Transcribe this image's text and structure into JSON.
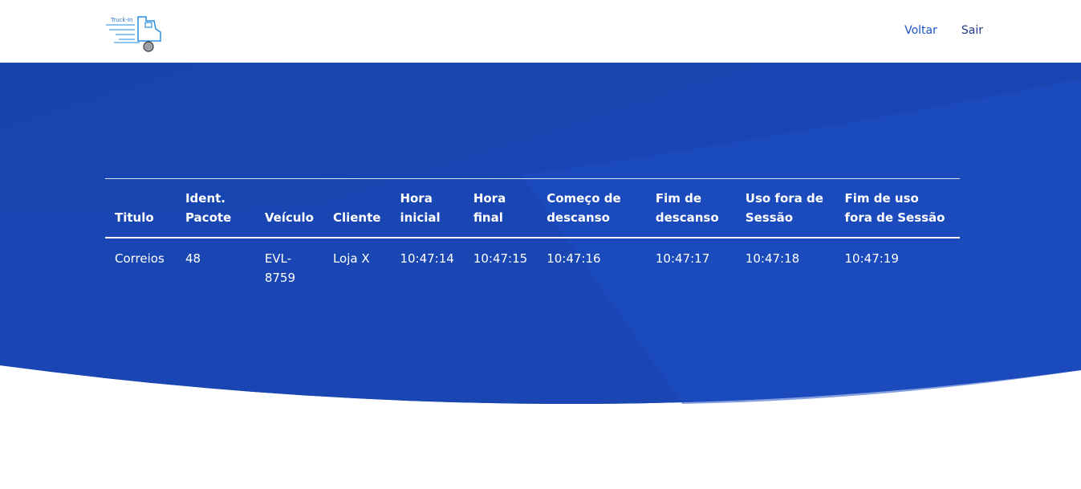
{
  "brand": {
    "logo_text": "Truck-In"
  },
  "nav": {
    "voltar": "Voltar",
    "sair": "Sair"
  },
  "table": {
    "headers": {
      "titulo": "Titulo",
      "ident": "Ident. Pacote",
      "veiculo": "Veículo",
      "cliente": "Cliente",
      "hora_inicial": "Hora inicial",
      "hora_final": "Hora final",
      "comeco_descanso": "Começo de descanso",
      "fim_descanso": "Fim de descanso",
      "uso_fora": "Uso fora de Sessão",
      "fim_uso_fora": "Fim de uso fora de Sessão"
    },
    "rows": [
      {
        "titulo": "Correios",
        "ident": "48",
        "veiculo": "EVL-8759",
        "cliente": "Loja X",
        "hora_inicial": "10:47:14",
        "hora_final": "10:47:15",
        "comeco_descanso": "10:47:16",
        "fim_descanso": "10:47:17",
        "uso_fora": "10:47:18",
        "fim_uso_fora": "10:47:19"
      }
    ]
  },
  "colors": {
    "hero_dark": "#1640a8",
    "hero_light": "#1d4fc4",
    "link": "#1a56c4",
    "link_dark": "#1e3a8a"
  }
}
